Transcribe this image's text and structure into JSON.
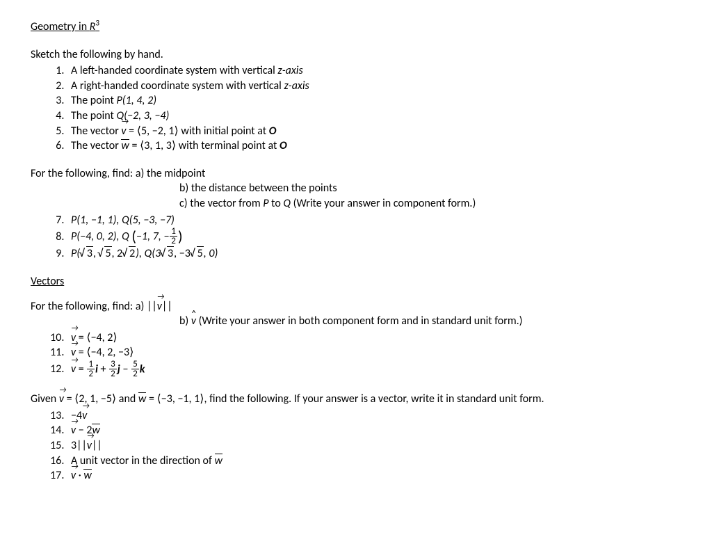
{
  "title_prefix": "Geometry in ",
  "title_var": "R",
  "title_sup": "3",
  "sketch_intro": "Sketch the following by hand.",
  "items_a": [
    "A left-handed coordinate system with vertical ",
    "A right-handed coordinate system with vertical ",
    "The point ",
    "The point ",
    "The vector ",
    "The vector "
  ],
  "z_axis": "z-axis",
  "p3": "P(1, 4, 2)",
  "q4": "Q(−2, 3, −4)",
  "v5_eq": " = ⟨5, −2, 1⟩ with initial point at ",
  "w6_eq": " = ⟨3, 1, 3⟩ with terminal point at ",
  "O": "O",
  "find_prefix": "For the following, find:   a) ",
  "find_a1": "the midpoint",
  "find_b1": "b) the distance between the points",
  "find_c1_pre": "c) the vector from ",
  "find_c1_mid": " to ",
  "find_c1_post": " (Write your answer in component form.)",
  "P": "P",
  "Q": "Q",
  "item7": "P(1, −1, 1), Q(5, −3, −7)",
  "item8_a": "P(−4, 0, 2), Q ",
  "item8_b": "−1, 7, −",
  "half_n": "1",
  "half_d": "2",
  "item9_p_open": "P(",
  "sqrt3": "3",
  "sqrt5": "5",
  "sqrt2": "2",
  "item9_comma": ", ",
  "item9_two": "2",
  "item9_close_pq": "), Q(3",
  "item9_neg3": ", −3",
  "item9_end": ", 0)",
  "vectors_heading": "Vectors",
  "find2_a_pre": "For the following, find:   a) ||",
  "find2_a_post": "||",
  "find2_b_pre": "b) ",
  "find2_b_post": " (Write your answer in both component form and in standard unit form.)",
  "v": "v",
  "w": "w",
  "item10": " = ⟨−4, 2⟩",
  "item11": " = ⟨−4, 2, −3⟩",
  "item12_eq": " = ",
  "plus": " + ",
  "minus": " − ",
  "three": "3",
  "five": "5",
  "i": "i",
  "j": "j",
  "k": "k",
  "given_pre": "Given ",
  "given_v": " = ⟨2, 1, −5⟩ and ",
  "given_w": " = ⟨−3, −1, 1⟩, find the following.  If your answer is a vector, write it in standard unit form.",
  "item13": "−4",
  "item14_mid": " − 2",
  "item15_pre": "3||",
  "item15_post": "||",
  "item16": "A unit vector in the direction of ",
  "item17_dot": " · "
}
